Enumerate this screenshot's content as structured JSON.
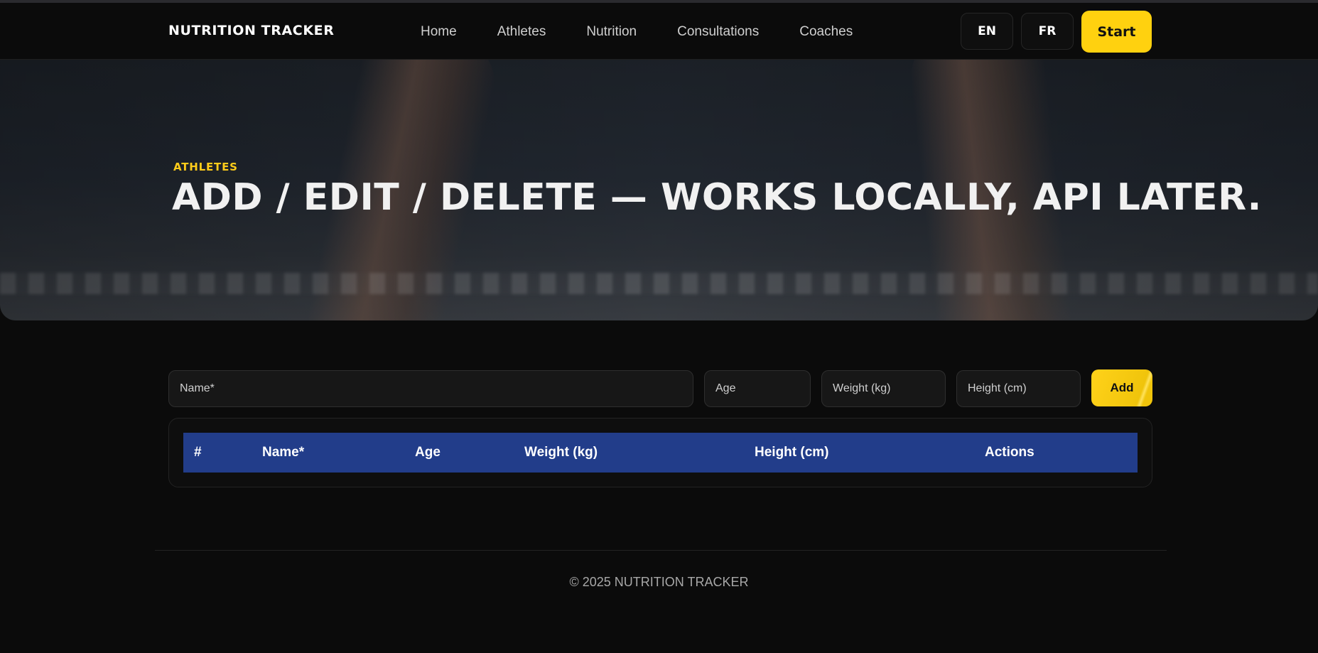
{
  "header": {
    "brand": "NUTRITION TRACKER",
    "nav": [
      "Home",
      "Athletes",
      "Nutrition",
      "Consultations",
      "Coaches"
    ],
    "lang_en": "EN",
    "lang_fr": "FR",
    "start_label": "Start"
  },
  "hero": {
    "eyebrow": "ATHLETES",
    "title": "ADD / EDIT / DELETE — WORKS LOCALLY, API LATER."
  },
  "form": {
    "name_placeholder": "Name*",
    "age_placeholder": "Age",
    "weight_placeholder": "Weight (kg)",
    "height_placeholder": "Height (cm)",
    "add_label": "Add"
  },
  "table": {
    "columns": [
      "#",
      "Name*",
      "Age",
      "Weight (kg)",
      "Height (cm)",
      "Actions"
    ],
    "rows": []
  },
  "footer": {
    "text": "© 2025 NUTRITION TRACKER"
  },
  "colors": {
    "accent": "#ffd10f",
    "table_header": "#223d8a",
    "background": "#0b0b0b"
  }
}
